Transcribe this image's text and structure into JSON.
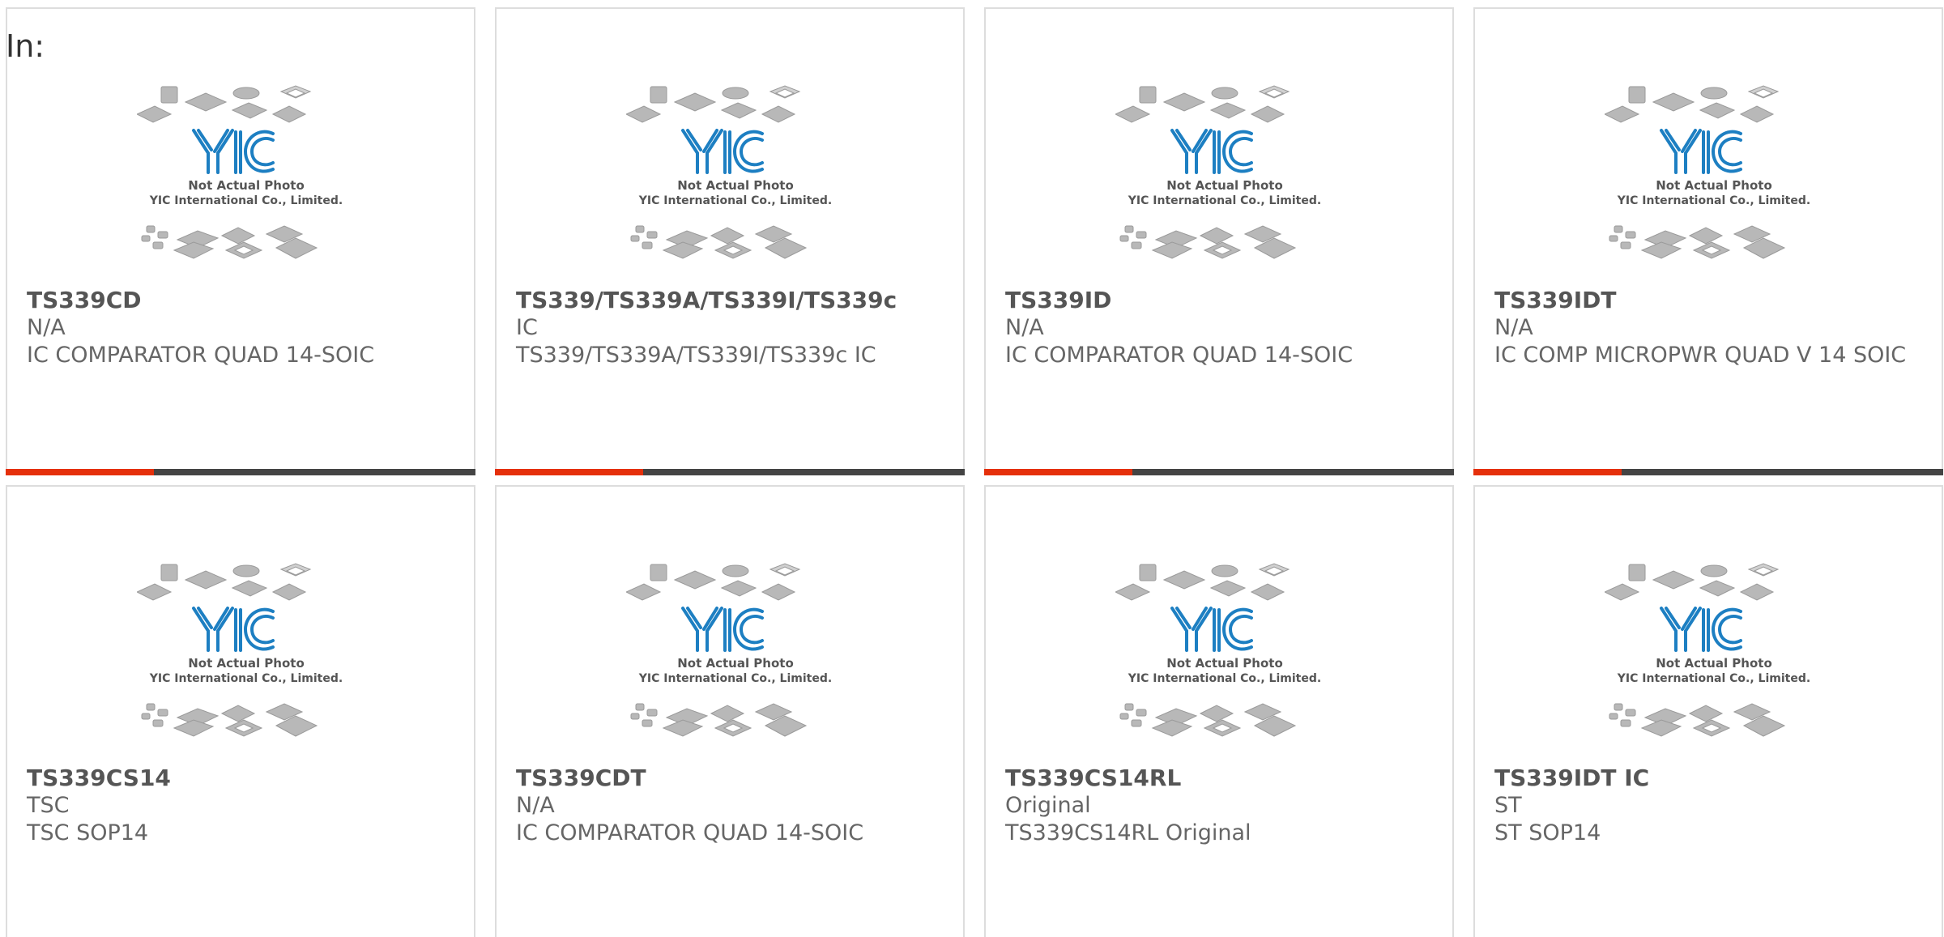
{
  "filter_label": "In:",
  "placeholder": {
    "line1": "Not Actual Photo",
    "line2": "YIC International Co., Limited.",
    "logo_text": "YIC"
  },
  "colors": {
    "accent": "#e5300b",
    "bar": "#444444",
    "border": "#dddddd",
    "logo_blue": "#1d7fc2"
  },
  "products": [
    {
      "part_number": "TS339CD",
      "manufacturer": "N/A",
      "description": "IC COMPARATOR QUAD 14-SOIC"
    },
    {
      "part_number": "TS339/TS339A/TS339I/TS339c",
      "manufacturer": "IC",
      "description": "TS339/TS339A/TS339I/TS339c IC"
    },
    {
      "part_number": "TS339ID",
      "manufacturer": "N/A",
      "description": "IC COMPARATOR QUAD 14-SOIC"
    },
    {
      "part_number": "TS339IDT",
      "manufacturer": "N/A",
      "description": "IC COMP MICROPWR QUAD V 14 SOIC"
    },
    {
      "part_number": "TS339CS14",
      "manufacturer": "TSC",
      "description": "TSC SOP14"
    },
    {
      "part_number": "TS339CDT",
      "manufacturer": "N/A",
      "description": "IC COMPARATOR QUAD 14-SOIC"
    },
    {
      "part_number": "TS339CS14RL",
      "manufacturer": "Original",
      "description": "TS339CS14RL Original"
    },
    {
      "part_number": "TS339IDT IC",
      "manufacturer": "ST",
      "description": "ST SOP14"
    }
  ]
}
